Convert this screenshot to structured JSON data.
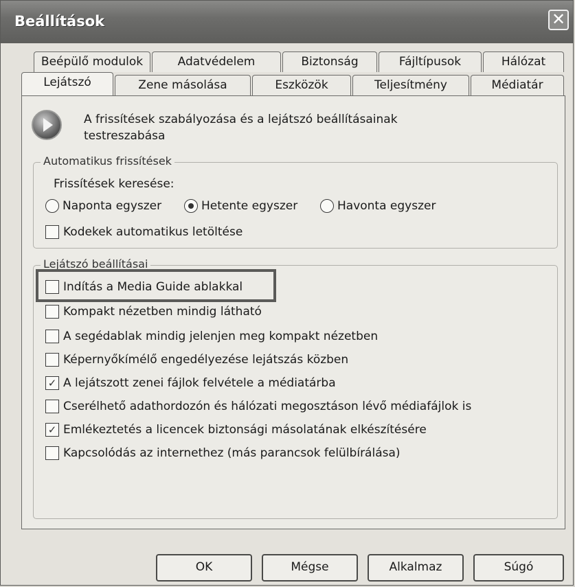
{
  "window": {
    "title": "Beállítások",
    "close_symbol": "✕"
  },
  "tabs_back": [
    {
      "label": "Beépülő modulok"
    },
    {
      "label": "Adatvédelem"
    },
    {
      "label": "Biztonság"
    },
    {
      "label": "Fájltípusok"
    },
    {
      "label": "Hálózat"
    }
  ],
  "tabs_front": [
    {
      "label": "Lejátszó",
      "active": true
    },
    {
      "label": "Zene másolása"
    },
    {
      "label": "Eszközök"
    },
    {
      "label": "Teljesítmény"
    },
    {
      "label": "Médiatár"
    }
  ],
  "header": {
    "icon": "play-icon",
    "text": "A frissítések szabályozása és a lejátszó beállításainak testreszabása"
  },
  "auto_updates": {
    "group_label": "Automatikus frissítések",
    "search_label": "Frissítések keresése:",
    "radio_options": [
      {
        "label": "Naponta egyszer",
        "selected": false
      },
      {
        "label": "Hetente egyszer",
        "selected": true
      },
      {
        "label": "Havonta egyszer",
        "selected": false
      }
    ],
    "codec_checkbox": {
      "label": "Kodekek automatikus letöltése",
      "checked": false
    }
  },
  "player_settings": {
    "group_label": "Lejátszó beállításai",
    "checkboxes": [
      {
        "label": "Indítás a Media Guide ablakkal",
        "checked": false
      },
      {
        "label": "Kompakt nézetben mindig látható",
        "checked": false
      },
      {
        "label": "A segédablak mindig jelenjen meg kompakt nézetben",
        "checked": false
      },
      {
        "label": "Képernyőkímélő engedélyezése lejátszás közben",
        "checked": false
      },
      {
        "label": "A lejátszott zenei fájlok felvétele a médiatárba",
        "checked": true
      },
      {
        "label": "Cserélhető adathordozón és hálózati megosztáson lévő médiafájlok is",
        "checked": false
      },
      {
        "label": "Emlékeztetés a licencek biztonsági másolatának elkészítésére",
        "checked": true
      },
      {
        "label": "Kapcsolódás az internethez (más parancsok felülbírálása)",
        "checked": false
      }
    ]
  },
  "buttons": {
    "ok": "OK",
    "cancel": "Mégse",
    "apply": "Alkalmaz",
    "help": "Súgó"
  },
  "check_mark": "✓"
}
